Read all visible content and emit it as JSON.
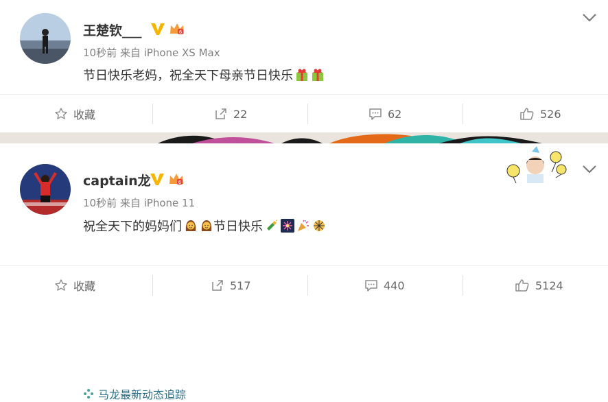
{
  "posts": [
    {
      "username": "王楚钦___",
      "meta": "10秒前 来自 iPhone XS Max",
      "text": "节日快乐老妈，祝全天下母亲节日快乐",
      "actions": {
        "favorite": "收藏",
        "repost": "22",
        "comment": "62",
        "like": "526"
      }
    },
    {
      "username": "captain龙",
      "meta": "10秒前 来自 iPhone 11",
      "text_a": "祝全天下的妈妈们",
      "text_b": "节日快乐",
      "link": "马龙最新动态追踪",
      "actions": {
        "favorite": "收藏",
        "repost": "517",
        "comment": "440",
        "like": "5124"
      }
    }
  ],
  "colors": {
    "verified": "#f7b500",
    "link": "#2f6f88",
    "meta": "#808080"
  }
}
